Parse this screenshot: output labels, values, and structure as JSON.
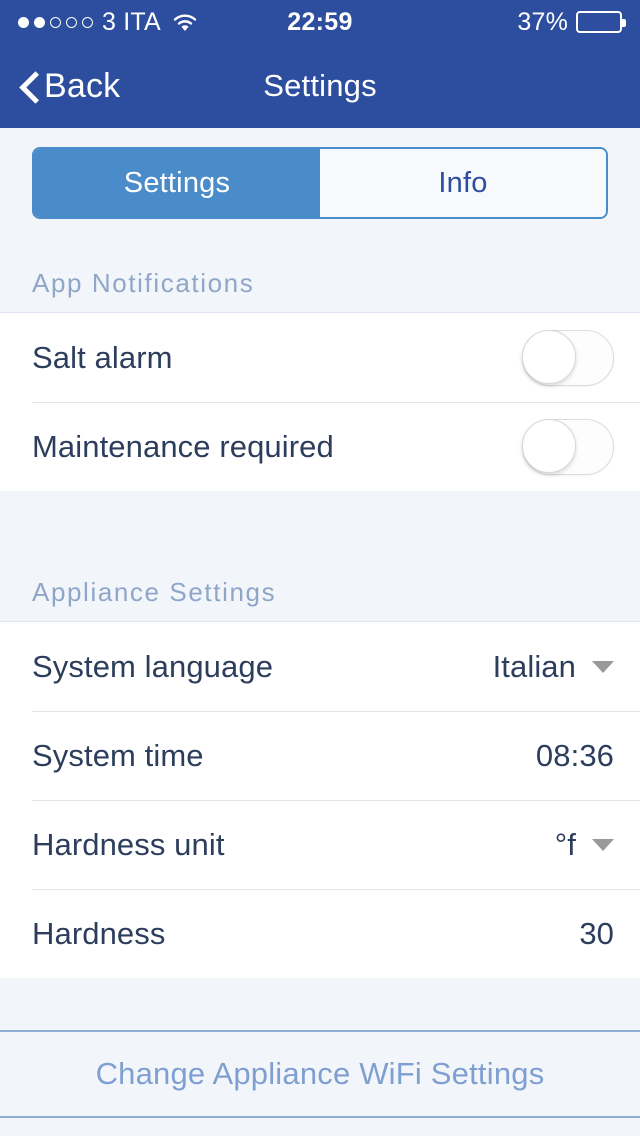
{
  "status_bar": {
    "signal_dots_total": 5,
    "signal_dots_filled": 2,
    "carrier": "3 ITA",
    "wifi_icon": "wifi-icon",
    "time": "22:59",
    "battery_percent_label": "37%",
    "battery_level": 37
  },
  "nav": {
    "back_label": "Back",
    "back_icon": "chevron-left-icon",
    "title": "Settings"
  },
  "tabs": [
    {
      "label": "Settings",
      "active": true
    },
    {
      "label": "Info",
      "active": false
    }
  ],
  "sections": [
    {
      "header": "App Notifications",
      "rows": [
        {
          "label": "Salt alarm",
          "control": "toggle",
          "value": "off"
        },
        {
          "label": "Maintenance required",
          "control": "toggle",
          "value": "off"
        }
      ]
    },
    {
      "header": "Appliance Settings",
      "rows": [
        {
          "label": "System language",
          "control": "dropdown",
          "value": "Italian"
        },
        {
          "label": "System time",
          "control": "text",
          "value": "08:36"
        },
        {
          "label": "Hardness unit",
          "control": "dropdown",
          "value": "°f"
        },
        {
          "label": "Hardness",
          "control": "text",
          "value": "30"
        }
      ]
    }
  ],
  "bottom_action": {
    "label": "Change Appliance WiFi Settings"
  },
  "colors": {
    "nav_blue": "#2d4e9e",
    "accent_blue": "#4a8cc9",
    "page_bg": "#f2f6fb",
    "row_bg": "#ffffff",
    "label_text": "#2d3e5c",
    "section_header_text": "#8fa6c8",
    "link_text": "#7f9fd0"
  }
}
